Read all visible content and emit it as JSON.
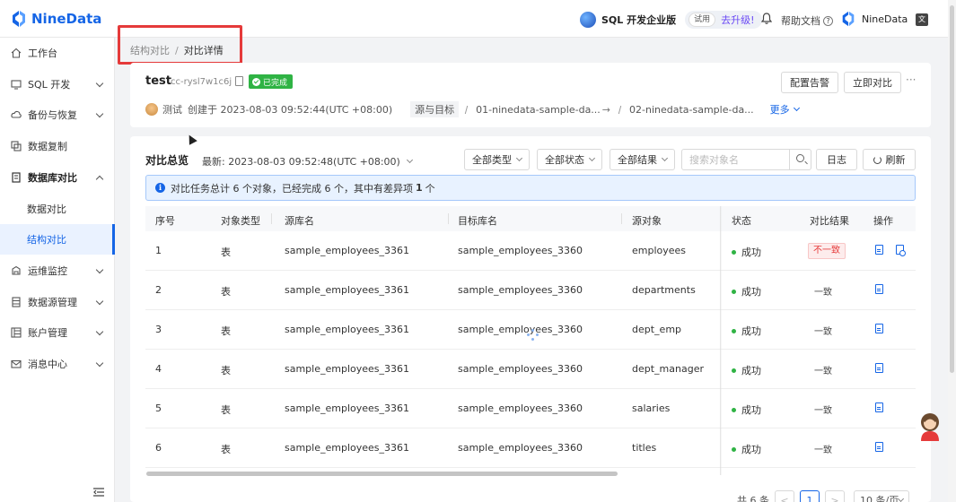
{
  "app": {
    "logo_text": "NineData",
    "edition": "SQL 开发企业版",
    "trial_tag": "试用",
    "upgrade": "去升级!",
    "help": "帮助文档",
    "help_q": "?",
    "user": "NineData",
    "lang_icon": "文"
  },
  "sidebar": {
    "items": [
      {
        "label": "工作台",
        "icon": "home-icon"
      },
      {
        "label": "SQL 开发",
        "icon": "sql-icon"
      },
      {
        "label": "备份与恢复",
        "icon": "cloud-icon"
      },
      {
        "label": "数据复制",
        "icon": "copy-icon"
      },
      {
        "label": "数据库对比",
        "icon": "compare-icon"
      },
      {
        "label": "数据对比",
        "icon": ""
      },
      {
        "label": "结构对比",
        "icon": ""
      },
      {
        "label": "运维监控",
        "icon": "monitor-icon"
      },
      {
        "label": "数据源管理",
        "icon": "datasource-icon"
      },
      {
        "label": "账户管理",
        "icon": "account-icon"
      },
      {
        "label": "消息中心",
        "icon": "mail-icon"
      }
    ]
  },
  "breadcrumb": {
    "parent": "结构对比",
    "sep": "/",
    "current": "对比详情"
  },
  "task": {
    "title": "test",
    "id": "cc-rysl7w1c6j",
    "status": "已完成",
    "alarm_btn": "配置告警",
    "compare_btn": "立即对比",
    "more_dots": "···",
    "owner": "测试",
    "created": "创建于 2023-08-03 09:52:44(UTC +08:00)",
    "src_label": "源与目标",
    "source": "01-ninedata-sample-da...",
    "arrow": "→",
    "target": "02-ninedata-sample-da...",
    "more": "更多"
  },
  "overview": {
    "title": "对比总览",
    "latest": "最新: 2023-08-03 09:52:48(UTC +08:00)",
    "filter_type": "全部类型",
    "filter_status": "全部状态",
    "filter_result": "全部结果",
    "search_placeholder": "搜索对象名",
    "log_btn": "日志",
    "refresh_btn": "刷新",
    "info_pre": "对比任务总计 6 个对象，已经完成 6 个，其中有差异项",
    "info_count": "1",
    "info_post": "个"
  },
  "table": {
    "headers": [
      "序号",
      "对象类型",
      "源库名",
      "目标库名",
      "源对象",
      "状态",
      "对比结果",
      "操作"
    ],
    "rows": [
      {
        "no": "1",
        "type": "表",
        "src_db": "sample_employees_3361",
        "dst_db": "sample_employees_3360",
        "obj": "employees",
        "status": "成功",
        "result": "不一致",
        "diff": true
      },
      {
        "no": "2",
        "type": "表",
        "src_db": "sample_employees_3361",
        "dst_db": "sample_employees_3360",
        "obj": "departments",
        "status": "成功",
        "result": "一致",
        "diff": false
      },
      {
        "no": "3",
        "type": "表",
        "src_db": "sample_employees_3361",
        "dst_db": "sample_employees_3360",
        "obj": "dept_emp",
        "status": "成功",
        "result": "一致",
        "diff": false
      },
      {
        "no": "4",
        "type": "表",
        "src_db": "sample_employees_3361",
        "dst_db": "sample_employees_3360",
        "obj": "dept_manager",
        "status": "成功",
        "result": "一致",
        "diff": false
      },
      {
        "no": "5",
        "type": "表",
        "src_db": "sample_employees_3361",
        "dst_db": "sample_employees_3360",
        "obj": "salaries",
        "status": "成功",
        "result": "一致",
        "diff": false
      },
      {
        "no": "6",
        "type": "表",
        "src_db": "sample_employees_3361",
        "dst_db": "sample_employees_3360",
        "obj": "titles",
        "status": "成功",
        "result": "一致",
        "diff": false
      }
    ]
  },
  "pager": {
    "total": "共 6 条",
    "prev": "<",
    "page": "1",
    "next": ">",
    "size": "10 条/页"
  },
  "colors": {
    "primary": "#1565e6",
    "success": "#2fb344",
    "danger": "#e53a3a",
    "highlight": "#e53a3a"
  }
}
